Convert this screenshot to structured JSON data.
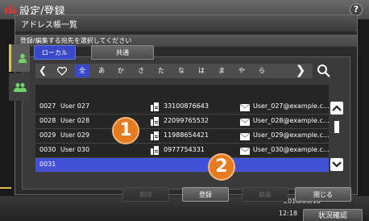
{
  "app": {
    "title": "設定/登録"
  },
  "help_label": "?",
  "dialog": {
    "title": "アドレス帳一覧",
    "instruction": "登録/編集する宛先を選択してください"
  },
  "tabs": {
    "local": "ローカル",
    "common": "共通"
  },
  "index": [
    "全",
    "あ",
    "か",
    "さ",
    "た",
    "な",
    "は",
    "ま",
    "や",
    "ら"
  ],
  "rows": [
    {
      "id": "0027",
      "name": "User 027",
      "fax": "33100876643",
      "email": "User_027@example.c…"
    },
    {
      "id": "0028",
      "name": "User 028",
      "fax": "22099765532",
      "email": "User_028@example.c…"
    },
    {
      "id": "0029",
      "name": "User 029",
      "fax": "11988654421",
      "email": "User_029@example.c…"
    },
    {
      "id": "0030",
      "name": "User 030",
      "fax": "0977754331",
      "email": "User_030@example.c…"
    },
    {
      "id": "0031",
      "name": "",
      "fax": "",
      "email": ""
    }
  ],
  "buttons": {
    "delete": "削除",
    "register": "登録",
    "edit": "編集",
    "close": "閉じる"
  },
  "status": {
    "date": "2018/05/10",
    "time": "12:18",
    "check": "状況確認"
  },
  "callouts": {
    "one": "1",
    "two": "2"
  },
  "colors": {
    "accent_blue": "#3a49c9",
    "callout_orange": "#e67a1e",
    "tab_indicator": "#d8c24a"
  },
  "icons": {
    "fax": "fax-icon",
    "email": "envelope-icon",
    "favorite": "heart-icon",
    "search": "search-icon"
  }
}
